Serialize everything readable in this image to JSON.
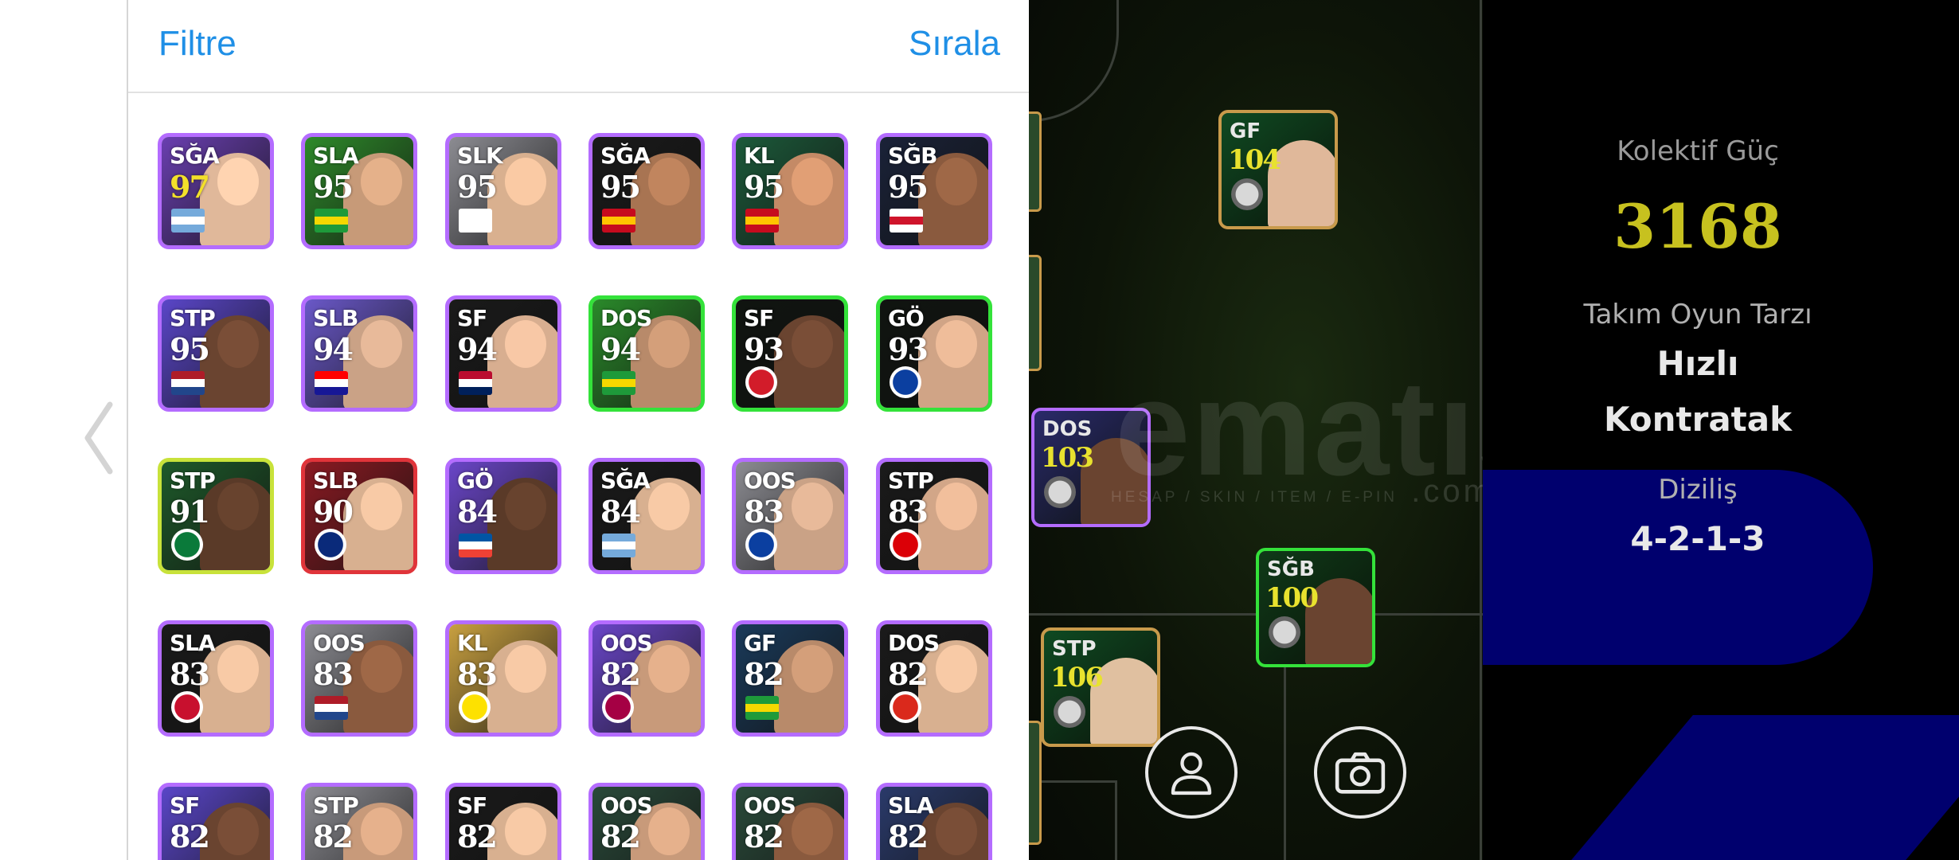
{
  "header": {
    "filter_label": "Filtre",
    "sort_label": "Sırala"
  },
  "players": [
    {
      "pos": "SĞA",
      "rating": "97",
      "gold": true,
      "frame": "#b46cff",
      "bg": "#6a3fb0",
      "face": "#e0b89a",
      "mark": "flag",
      "mark_colors": [
        "#75aadb",
        "#ffffff",
        "#75aadb"
      ]
    },
    {
      "pos": "SLA",
      "rating": "95",
      "frame": "#b46cff",
      "bg": "#2e8a2a",
      "face": "#c79a78",
      "mark": "flag",
      "mark_colors": [
        "#1e9a3a",
        "#f5d800",
        "#1e9a3a"
      ]
    },
    {
      "pos": "SLK",
      "rating": "95",
      "frame": "#b46cff",
      "bg": "#8c8c92",
      "face": "#d9b08f",
      "mark": "flag",
      "mark_colors": [
        "#ffffff",
        "#ffffff",
        "#ffffff"
      ]
    },
    {
      "pos": "SĞA",
      "rating": "95",
      "frame": "#b46cff",
      "bg": "#1a1a1a",
      "face": "#a87452",
      "mark": "flag",
      "mark_colors": [
        "#c60b1e",
        "#ffc400",
        "#c60b1e"
      ]
    },
    {
      "pos": "KL",
      "rating": "95",
      "frame": "#b46cff",
      "bg": "#1c5a3a",
      "face": "#c48a66",
      "mark": "flag",
      "mark_colors": [
        "#c60b1e",
        "#ffc400",
        "#c60b1e"
      ]
    },
    {
      "pos": "SĞB",
      "rating": "95",
      "frame": "#b46cff",
      "bg": "#1a2238",
      "face": "#8a5a3e",
      "mark": "flag",
      "mark_colors": [
        "#ffffff",
        "#cf142b",
        "#ffffff"
      ]
    },
    {
      "pos": "STP",
      "rating": "95",
      "frame": "#b46cff",
      "bg": "#5a46c8",
      "face": "#6a4430",
      "mark": "flag",
      "mark_colors": [
        "#ae1c28",
        "#ffffff",
        "#21468b"
      ]
    },
    {
      "pos": "SLB",
      "rating": "94",
      "frame": "#b46cff",
      "bg": "#6a58c8",
      "face": "#caa286",
      "mark": "flag",
      "mark_colors": [
        "#ff0000",
        "#ffffff",
        "#171796"
      ]
    },
    {
      "pos": "SF",
      "rating": "94",
      "frame": "#b46cff",
      "bg": "#1a1a1a",
      "face": "#d8ae90",
      "mark": "flag",
      "mark_colors": [
        "#ba0c2f",
        "#ffffff",
        "#00205b"
      ]
    },
    {
      "pos": "DOS",
      "rating": "94",
      "frame": "#34e23a",
      "bg": "#2a8a2a",
      "face": "#b88a6a",
      "mark": "flag",
      "mark_colors": [
        "#1e9a3a",
        "#f5d800",
        "#1e9a3a"
      ]
    },
    {
      "pos": "SF",
      "rating": "93",
      "frame": "#34e23a",
      "bg": "#101410",
      "face": "#6a4430",
      "mark": "badge",
      "mark_colors": [
        "#d21c2a"
      ]
    },
    {
      "pos": "GÖ",
      "rating": "93",
      "frame": "#34e23a",
      "bg": "#101410",
      "face": "#d0a486",
      "mark": "badge",
      "mark_colors": [
        "#0b3fa0"
      ]
    },
    {
      "pos": "STP",
      "rating": "91",
      "frame": "#c8e23a",
      "bg": "#1e5a2a",
      "face": "#5a3a28",
      "mark": "badge",
      "mark_colors": [
        "#0a7a3a"
      ]
    },
    {
      "pos": "SLB",
      "rating": "90",
      "frame": "#e0343a",
      "bg": "#8a1a22",
      "face": "#d8b090",
      "mark": "badge",
      "mark_colors": [
        "#0a2a7a"
      ]
    },
    {
      "pos": "GÖ",
      "rating": "84",
      "frame": "#b46cff",
      "bg": "#6a46c8",
      "face": "#5a3a28",
      "mark": "flag",
      "mark_colors": [
        "#0055a4",
        "#ffffff",
        "#ef4135"
      ]
    },
    {
      "pos": "SĞA",
      "rating": "84",
      "frame": "#b46cff",
      "bg": "#1a1a1a",
      "face": "#d8b090",
      "mark": "flag",
      "mark_colors": [
        "#75aadb",
        "#ffffff",
        "#75aadb"
      ]
    },
    {
      "pos": "OOS",
      "rating": "83",
      "frame": "#b46cff",
      "bg": "#8c8c92",
      "face": "#caa286",
      "mark": "badge",
      "mark_colors": [
        "#0b3fa0"
      ]
    },
    {
      "pos": "STP",
      "rating": "83",
      "frame": "#b46cff",
      "bg": "#1a1a1a",
      "face": "#d2a688",
      "mark": "badge",
      "mark_colors": [
        "#db0007"
      ]
    },
    {
      "pos": "SLA",
      "rating": "83",
      "frame": "#b46cff",
      "bg": "#1a1a1a",
      "face": "#d8b090",
      "mark": "badge",
      "mark_colors": [
        "#c8102e"
      ]
    },
    {
      "pos": "OOS",
      "rating": "83",
      "frame": "#b46cff",
      "bg": "#8c8c92",
      "face": "#8a5a3e",
      "mark": "flag",
      "mark_colors": [
        "#ae1c28",
        "#ffffff",
        "#21468b"
      ]
    },
    {
      "pos": "KL",
      "rating": "83",
      "frame": "#b46cff",
      "bg": "#c8a040",
      "face": "#d8b090",
      "mark": "badge",
      "mark_colors": [
        "#fde100"
      ]
    },
    {
      "pos": "OOS",
      "rating": "82",
      "frame": "#b46cff",
      "bg": "#6a46c8",
      "face": "#c89a7a",
      "mark": "badge",
      "mark_colors": [
        "#a50044"
      ]
    },
    {
      "pos": "GF",
      "rating": "82",
      "frame": "#b46cff",
      "bg": "#1a3a5a",
      "face": "#b88a6a",
      "mark": "flag",
      "mark_colors": [
        "#1e9a3a",
        "#f5d800",
        "#1e9a3a"
      ]
    },
    {
      "pos": "DOS",
      "rating": "82",
      "frame": "#b46cff",
      "bg": "#1a1a1a",
      "face": "#d8b090",
      "mark": "badge",
      "mark_colors": [
        "#da291c"
      ]
    },
    {
      "pos": "SF",
      "rating": "82",
      "frame": "#b46cff",
      "bg": "#5a46c8",
      "face": "#6a4430",
      "mark": "none",
      "mark_colors": []
    },
    {
      "pos": "STP",
      "rating": "82",
      "frame": "#b46cff",
      "bg": "#8c8c92",
      "face": "#c89a7a",
      "mark": "none",
      "mark_colors": []
    },
    {
      "pos": "SF",
      "rating": "82",
      "frame": "#b46cff",
      "bg": "#1a1a1a",
      "face": "#d8b090",
      "mark": "none",
      "mark_colors": []
    },
    {
      "pos": "OOS",
      "rating": "82",
      "frame": "#b46cff",
      "bg": "#2a4a3a",
      "face": "#c89a7a",
      "mark": "none",
      "mark_colors": []
    },
    {
      "pos": "OOS",
      "rating": "82",
      "frame": "#b46cff",
      "bg": "#2a4a3a",
      "face": "#8a5a3e",
      "mark": "none",
      "mark_colors": []
    },
    {
      "pos": "SLA",
      "rating": "82",
      "frame": "#b46cff",
      "bg": "#2a3a6a",
      "face": "#6a4430",
      "mark": "none",
      "mark_colors": []
    }
  ],
  "field_players": [
    {
      "pos": "GF",
      "rating": "104",
      "frame": "#c89a4b",
      "bg": "#0f4a22",
      "face": "#e0b89a"
    },
    {
      "pos": "DOS",
      "rating": "103",
      "frame": "#b46cff",
      "bg": "#2a2a6a",
      "face": "#6a4430"
    },
    {
      "pos": "SĞB",
      "rating": "100",
      "frame": "#34e23a",
      "bg": "#0f3a18",
      "face": "#6a4430"
    },
    {
      "pos": "STP",
      "rating": "106",
      "frame": "#c89a4b",
      "bg": "#0f4a22",
      "face": "#e0c0a0"
    }
  ],
  "watermark": {
    "main": "ematış",
    "sub": "HESAP / SKIN / ITEM / E-PIN",
    "com": ".com"
  },
  "stats": {
    "collective_label": "Kolektif Güç",
    "collective_value": "3168",
    "style_label": "Takım Oyun Tarzı",
    "style_line1": "Hızlı",
    "style_line2": "Kontratak",
    "formation_label": "Diziliş",
    "formation_value": "4-2-1-3"
  }
}
